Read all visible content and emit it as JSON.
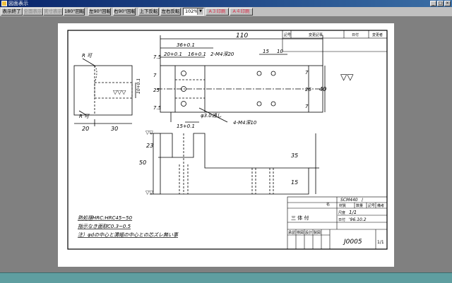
{
  "window": {
    "title": "図面表示"
  },
  "toolbar": {
    "buttons": [
      "表示終了",
      "全面表示",
      "実寸表示",
      "180°回転",
      "左90°回転",
      "右90°回転",
      "上下反転",
      "左右反転"
    ],
    "zoom": "102%",
    "print_a3": "A３印刷",
    "print_a4": "A４印刷"
  },
  "drawing": {
    "dims": {
      "d110": "110",
      "d36": "36+0.1",
      "d20": "20+0.1",
      "d16": "16+0.1",
      "d15": "15",
      "d10": "10",
      "d7a": "7",
      "d26": "26",
      "d40": "40",
      "d7b": "7",
      "d7c": "7",
      "d25": "25",
      "d7_5a": "7.5",
      "d7_5b": "7.5",
      "d10s": "10+0.1",
      "d20b": "20",
      "d30": "30",
      "d15b": "15+0.1",
      "d23": "23",
      "d50": "50",
      "d35": "35",
      "d15c": "15"
    },
    "notes": {
      "r_top": "R 可",
      "r_bot": "R 可",
      "m4_top": "2-M4深20",
      "m4_bot": "4-M4深10",
      "phi": "φ3.0通し",
      "note1": "熱処理HRC:HRC45~50",
      "note2": "指示なき面取C0.3~0.5",
      "note3": "注）φdの中心と溝幅の中心との芯ズレ無い事"
    },
    "title_block": {
      "header": [
        "記号",
        "変更記事",
        "日付",
        "変更者"
      ],
      "material": "SCM440",
      "material_slash": "/",
      "cols": [
        "材質",
        "数量",
        "記号",
        "備考"
      ],
      "scale_label": "尺度",
      "scale": "1/1",
      "date_label": "日付",
      "date": "'96.10.2",
      "name_label": "名",
      "part_name": "三 体 付",
      "roles": [
        "承認",
        "検図",
        "設計",
        "製図"
      ],
      "dwg_no": "J0005",
      "sheet": "1/1"
    }
  }
}
